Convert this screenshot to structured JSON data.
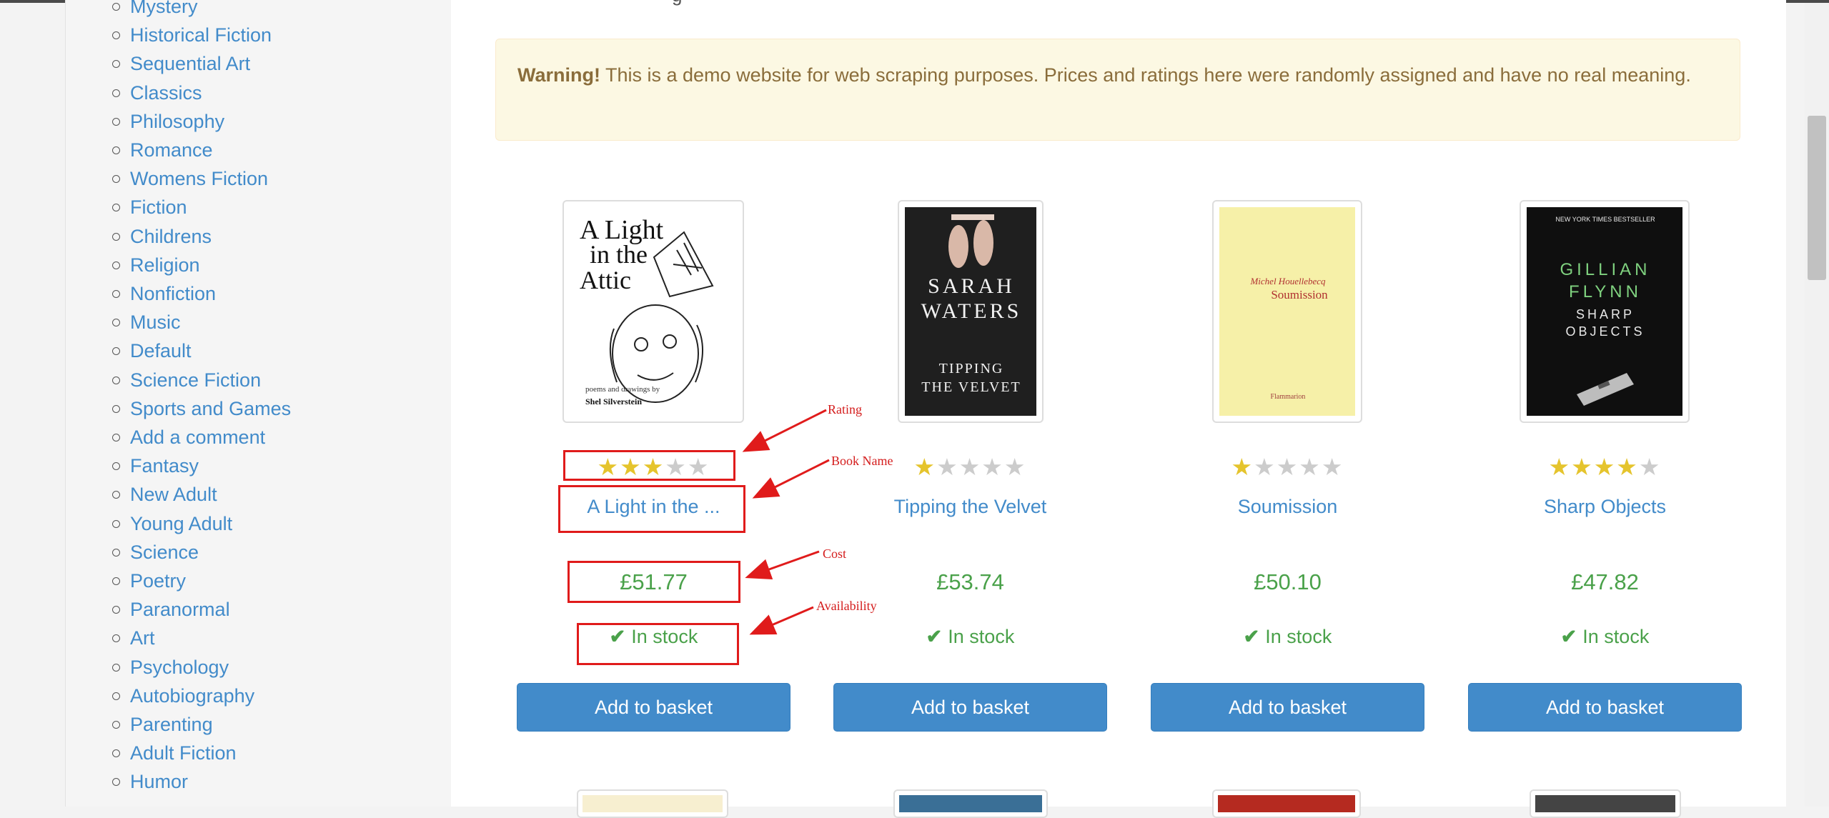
{
  "sidebar": {
    "categories": [
      "Mystery",
      "Historical Fiction",
      "Sequential Art",
      "Classics",
      "Philosophy",
      "Romance",
      "Womens Fiction",
      "Fiction",
      "Childrens",
      "Religion",
      "Nonfiction",
      "Music",
      "Default",
      "Science Fiction",
      "Sports and Games",
      "Add a comment",
      "Fantasy",
      "New Adult",
      "Young Adult",
      "Science",
      "Poetry",
      "Paranormal",
      "Art",
      "Psychology",
      "Autobiography",
      "Parenting",
      "Adult Fiction",
      "Humor"
    ]
  },
  "header_cutoff": "g",
  "warning": {
    "strong": "Warning!",
    "text": " This is a demo website for web scraping purposes. Prices and ratings here were randomly assigned and have no real meaning."
  },
  "books": [
    {
      "title": "A Light in the ...",
      "price": "£51.77",
      "availability": "In stock",
      "rating": 3,
      "button": "Add to basket",
      "cover": {
        "line1": "A Light",
        "line2": "in the",
        "line3": "Attic",
        "subtitle": "poems and drawings by",
        "author": "Shel Silverstein"
      }
    },
    {
      "title": "Tipping the Velvet",
      "price": "£53.74",
      "availability": "In stock",
      "rating": 1,
      "button": "Add to basket",
      "cover": {
        "author1": "SARAH",
        "author2": "WATERS",
        "title1": "TIPPING",
        "title2": "THE VELVET"
      }
    },
    {
      "title": "Soumission",
      "price": "£50.10",
      "availability": "In stock",
      "rating": 1,
      "button": "Add to basket",
      "cover": {
        "author": "Michel Houellebecq",
        "title": "Soumission",
        "publisher": "Flammarion"
      }
    },
    {
      "title": "Sharp Objects",
      "price": "£47.82",
      "availability": "In stock",
      "rating": 4,
      "button": "Add to basket",
      "cover": {
        "top": "NEW YORK TIMES BESTSELLER",
        "author1": "GILLIAN",
        "author2": "FLYNN",
        "title1": "SHARP",
        "title2": "OBJECTS"
      }
    }
  ],
  "annotations": {
    "rating": "Rating",
    "book_name": "Book Name",
    "cost": "Cost",
    "availability": "Availability"
  },
  "colors": {
    "link": "#428bca",
    "price": "#4aa14a",
    "star": "#e5c42d",
    "button": "#428bca",
    "annotation": "#e01b1b",
    "warning_bg": "#fcf8e3"
  }
}
